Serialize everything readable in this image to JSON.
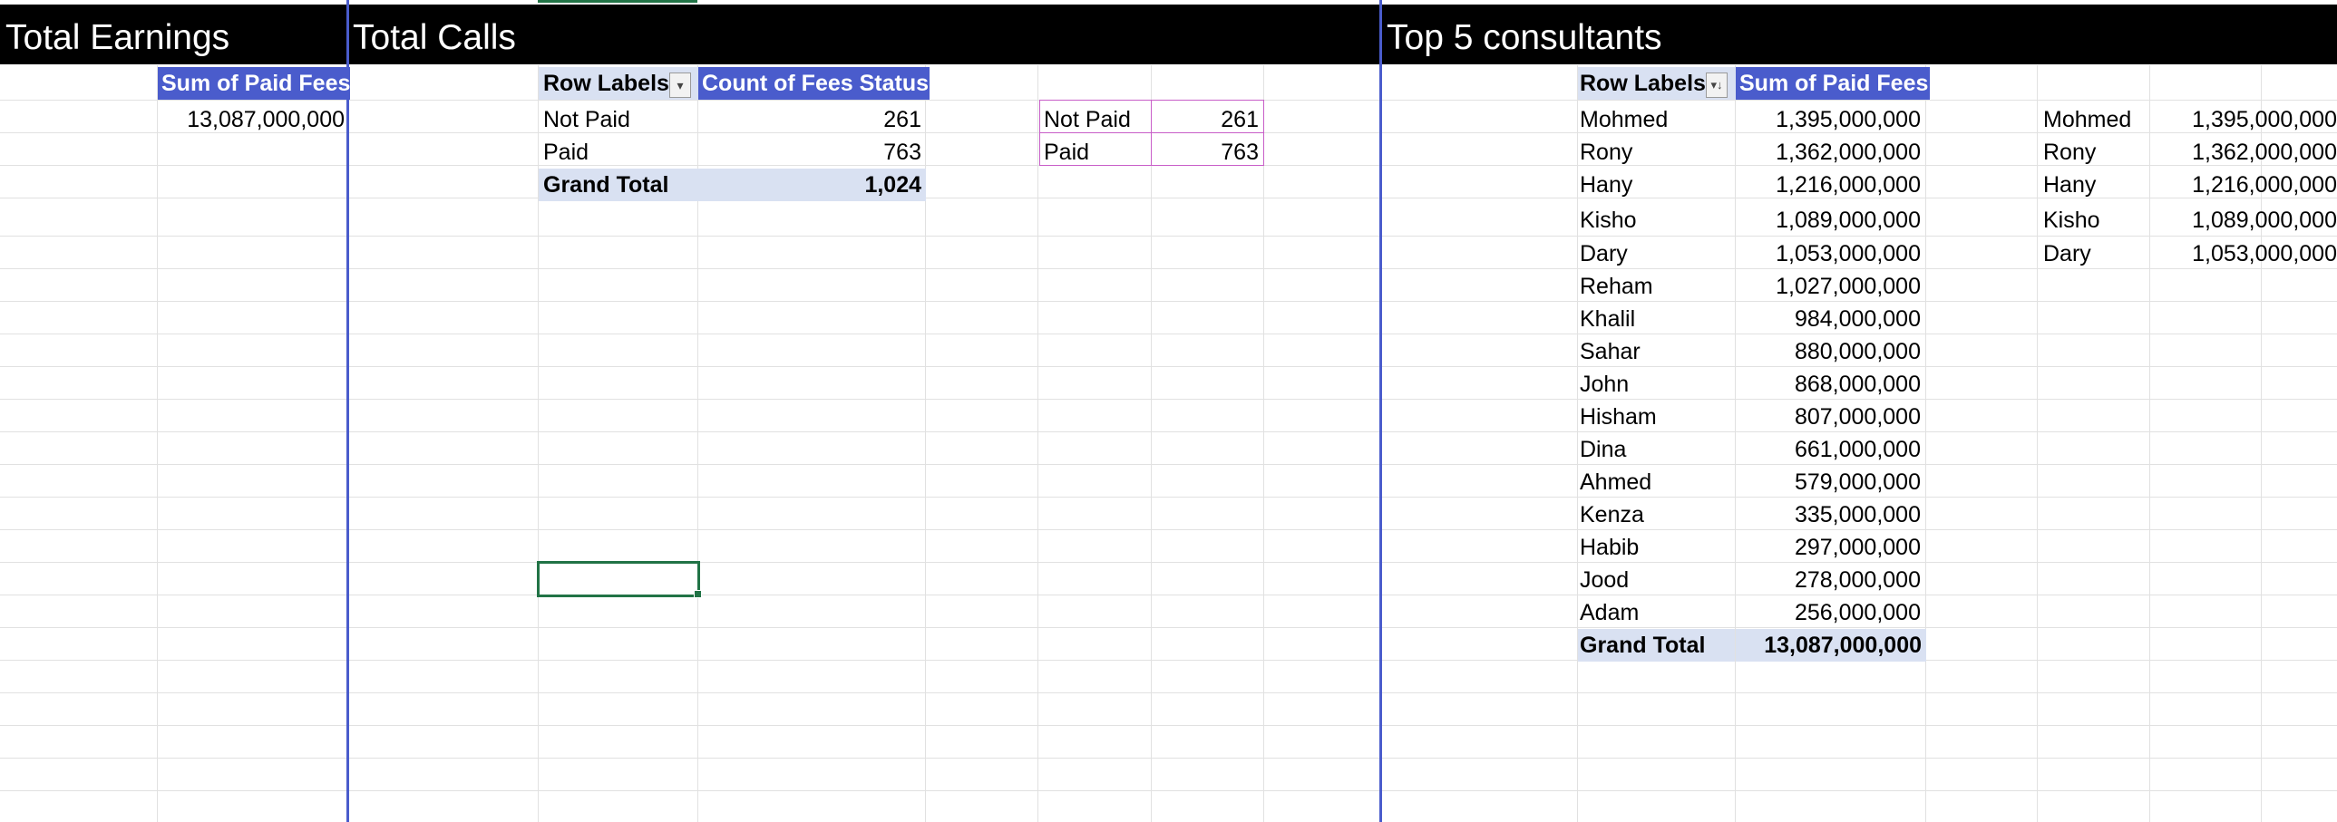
{
  "sections": {
    "earnings_title": "Total Earnings",
    "calls_title": "Total Calls",
    "top5_title": "Top 5 consultants"
  },
  "earnings_pivot": {
    "header": "Sum of Paid Fees",
    "value": "13,087,000,000"
  },
  "calls_pivot": {
    "row_header": "Row Labels",
    "value_header": "Count of Fees Status",
    "rows": [
      {
        "label": "Not Paid",
        "value": "261"
      },
      {
        "label": "Paid",
        "value": "763"
      }
    ],
    "grand_total_label": "Grand Total",
    "grand_total_value": "1,024"
  },
  "calls_copy": [
    {
      "label": "Not Paid",
      "value": "261"
    },
    {
      "label": "Paid",
      "value": "763"
    }
  ],
  "consultants_pivot": {
    "row_header": "Row Labels",
    "value_header": "Sum of Paid Fees",
    "rows": [
      {
        "name": "Mohmed",
        "value": "1,395,000,000"
      },
      {
        "name": "Rony",
        "value": "1,362,000,000"
      },
      {
        "name": "Hany",
        "value": "1,216,000,000"
      },
      {
        "name": "Kisho",
        "value": "1,089,000,000"
      },
      {
        "name": "Dary",
        "value": "1,053,000,000"
      },
      {
        "name": "Reham",
        "value": "1,027,000,000"
      },
      {
        "name": "Khalil",
        "value": "984,000,000"
      },
      {
        "name": "Sahar",
        "value": "880,000,000"
      },
      {
        "name": "John",
        "value": "868,000,000"
      },
      {
        "name": "Hisham",
        "value": "807,000,000"
      },
      {
        "name": "Dina",
        "value": "661,000,000"
      },
      {
        "name": "Ahmed",
        "value": "579,000,000"
      },
      {
        "name": "Kenza",
        "value": "335,000,000"
      },
      {
        "name": "Habib",
        "value": "297,000,000"
      },
      {
        "name": "Jood",
        "value": "278,000,000"
      },
      {
        "name": "Adam",
        "value": "256,000,000"
      }
    ],
    "grand_total_label": "Grand Total",
    "grand_total_value": "13,087,000,000"
  },
  "top5_list": [
    {
      "name": "Mohmed",
      "value": "1,395,000,000"
    },
    {
      "name": "Rony",
      "value": "1,362,000,000"
    },
    {
      "name": "Hany",
      "value": "1,216,000,000"
    },
    {
      "name": "Kisho",
      "value": "1,089,000,000"
    },
    {
      "name": "Dary",
      "value": "1,053,000,000"
    }
  ],
  "icons": {
    "row_labels_filter": "filter-dropdown-icon",
    "row_labels_sort": "sort-descending-icon"
  },
  "colors": {
    "pivot_header": "#4a5ccc",
    "pivot_total": "#d9e1f2",
    "title_bar": "#000000",
    "selection": "#217346"
  }
}
